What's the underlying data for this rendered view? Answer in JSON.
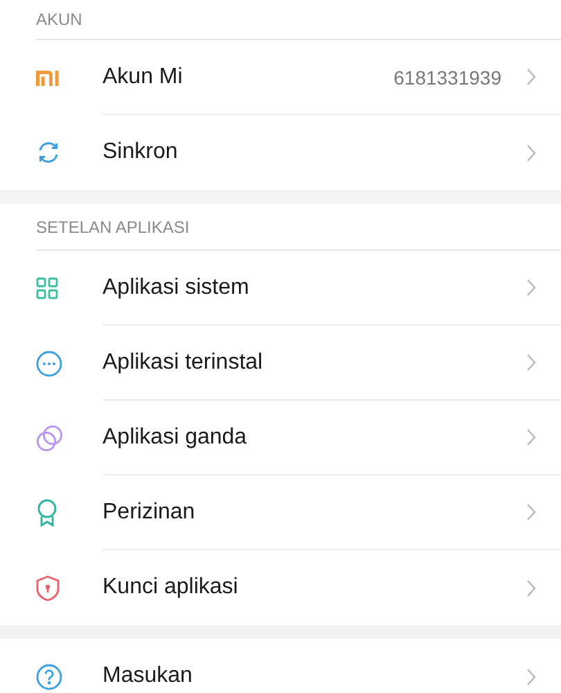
{
  "sections": [
    {
      "header": "AKUN",
      "items": [
        {
          "label": "Akun Mi",
          "value": "6181331939"
        },
        {
          "label": "Sinkron"
        }
      ]
    },
    {
      "header": "SETELAN APLIKASI",
      "items": [
        {
          "label": "Aplikasi sistem"
        },
        {
          "label": "Aplikasi terinstal"
        },
        {
          "label": "Aplikasi ganda"
        },
        {
          "label": "Perizinan"
        },
        {
          "label": "Kunci aplikasi"
        }
      ]
    },
    {
      "items": [
        {
          "label": "Masukan"
        }
      ]
    }
  ]
}
